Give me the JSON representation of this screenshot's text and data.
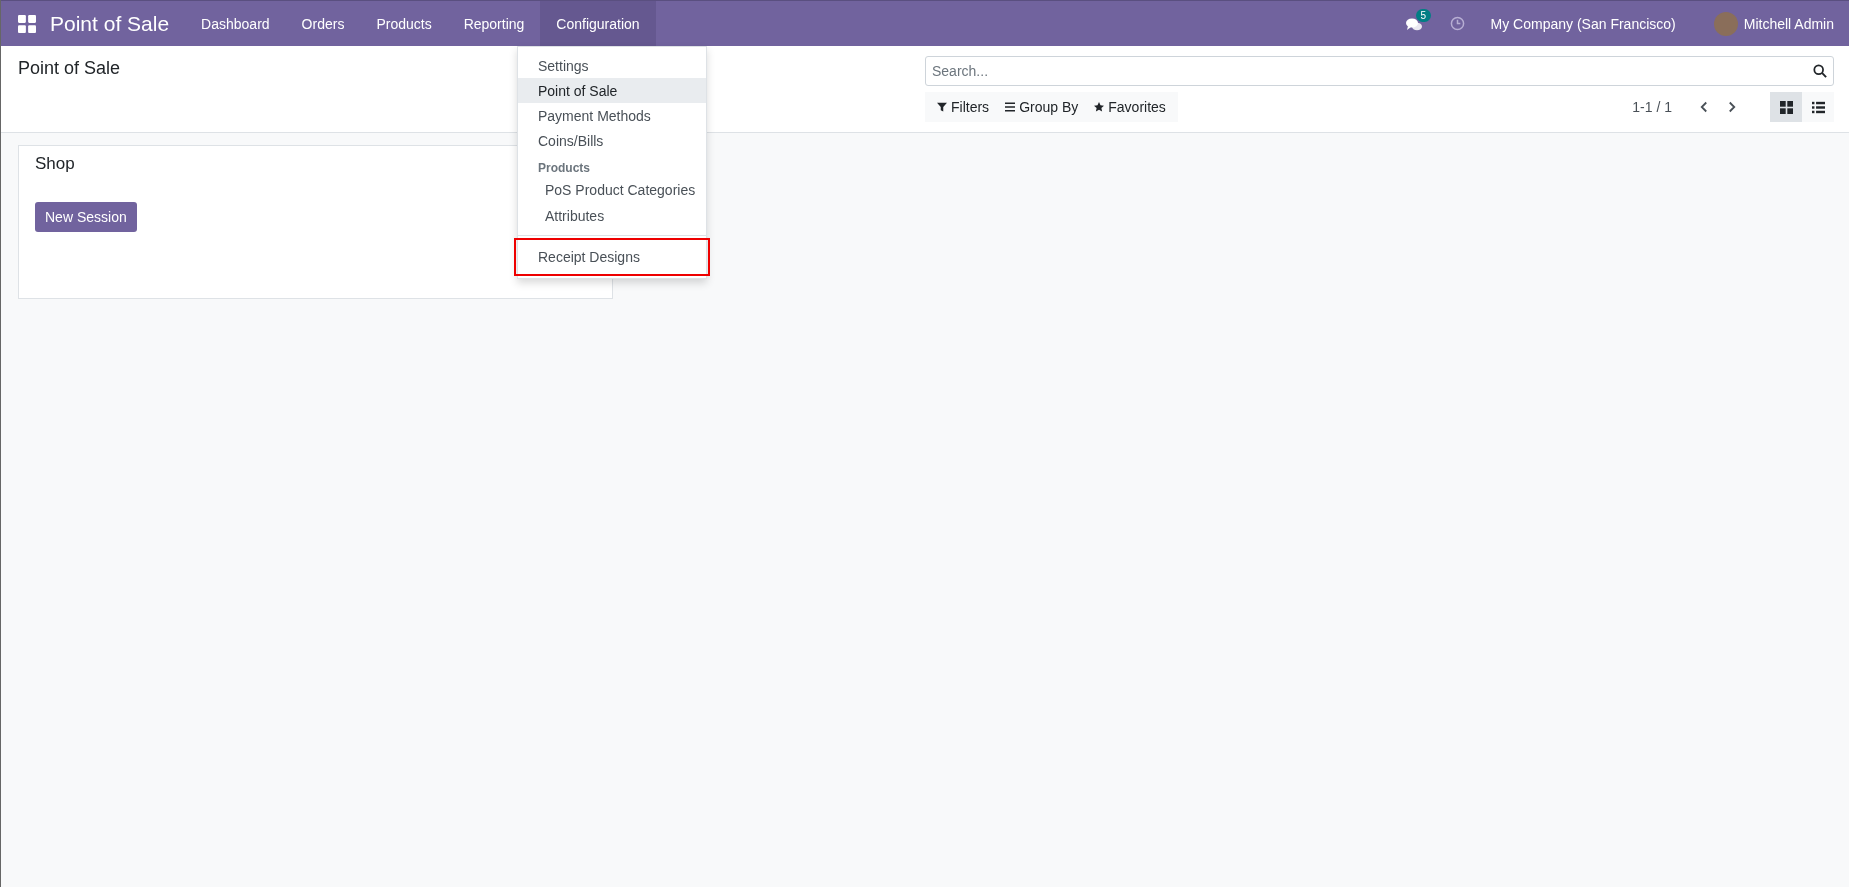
{
  "navbar": {
    "brand": "Point of Sale",
    "menu": [
      {
        "label": "Dashboard",
        "selected": false
      },
      {
        "label": "Orders",
        "selected": false
      },
      {
        "label": "Products",
        "selected": false
      },
      {
        "label": "Reporting",
        "selected": false
      },
      {
        "label": "Configuration",
        "selected": true
      }
    ],
    "messages_badge": "5",
    "company": "My Company (San Francisco)",
    "user": "Mitchell Admin"
  },
  "dropdown": {
    "items": [
      {
        "kind": "item",
        "label": "Settings",
        "hovered": false,
        "outlined": false
      },
      {
        "kind": "item",
        "label": "Point of Sale",
        "hovered": true,
        "outlined": false
      },
      {
        "kind": "item",
        "label": "Payment Methods",
        "hovered": false,
        "outlined": false
      },
      {
        "kind": "item",
        "label": "Coins/Bills",
        "hovered": false,
        "outlined": false
      },
      {
        "kind": "header",
        "label": "Products",
        "children": [
          {
            "label": "PoS Product Categories",
            "hovered": false
          },
          {
            "label": "Attributes",
            "hovered": false
          }
        ]
      },
      {
        "kind": "divider"
      },
      {
        "kind": "item",
        "label": "Receipt Designs",
        "hovered": false,
        "outlined": true
      }
    ]
  },
  "control_panel": {
    "title": "Point of Sale",
    "search": {
      "placeholder": "Search..."
    },
    "filters": [
      "Filters",
      "Group By",
      "Favorites"
    ],
    "pager": "1-1 / 1",
    "views": [
      {
        "kind": "kanban",
        "selected": true
      },
      {
        "kind": "list",
        "selected": false
      }
    ]
  },
  "cards": [
    {
      "title": "Shop",
      "button": "New Session"
    }
  ]
}
